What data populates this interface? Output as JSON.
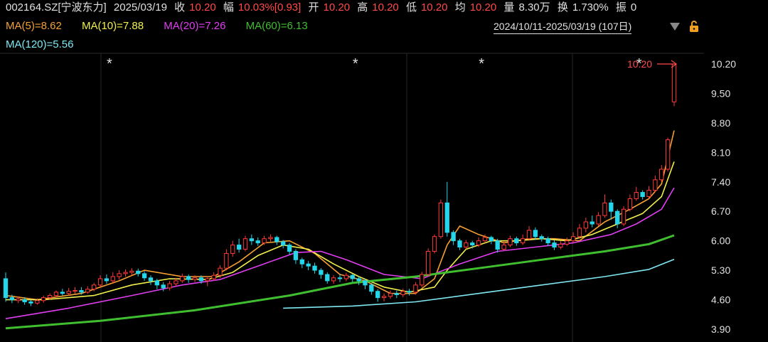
{
  "header": {
    "code": "002164.SZ[宁波东力]",
    "date": "2025/03/19",
    "close_label": "收",
    "close": "10.20",
    "change_label": "幅",
    "change": "10.03%[0.93]",
    "open_label": "开",
    "open": "10.20",
    "high_label": "高",
    "high": "10.20",
    "low_label": "低",
    "low": "10.20",
    "avg_label": "均",
    "avg": "10.20",
    "vol_label": "量",
    "vol": "8.30万",
    "turnover_label": "换",
    "turnover": "1.730%",
    "amp_label": "振",
    "amp": "0"
  },
  "ma": {
    "ma5": "MA(5)=8.62",
    "ma10": "MA(10)=7.88",
    "ma20": "MA(20)=7.26",
    "ma60": "MA(60)=6.13",
    "ma120": "MA(120)=5.56"
  },
  "range_label": "2024/10/11-2025/03/19 (107日)",
  "price_marker": "10.20",
  "colors": {
    "up": "#ff3b3b",
    "down": "#25d6ea",
    "ma5": "#f5a033",
    "ma10": "#f2ef4c",
    "ma20": "#e03ef0",
    "ma60": "#3fbf2f",
    "ma120": "#7fe8f2"
  },
  "chart_data": {
    "type": "candlestick",
    "ylim": [
      3.9,
      10.6
    ],
    "yticks": [
      "10.20",
      "9.50",
      "8.80",
      "8.10",
      "7.40",
      "6.70",
      "6.00",
      "5.30",
      "4.60",
      "3.90"
    ],
    "marker_x": [
      16,
      55,
      75,
      100
    ],
    "candles": [
      [
        5.1,
        4.65,
        5.25,
        4.55
      ],
      [
        4.65,
        4.6,
        4.72,
        4.52
      ],
      [
        4.58,
        4.62,
        4.68,
        4.52
      ],
      [
        4.6,
        4.55,
        4.66,
        4.48
      ],
      [
        4.55,
        4.52,
        4.6,
        4.45
      ],
      [
        4.52,
        4.58,
        4.63,
        4.48
      ],
      [
        4.58,
        4.65,
        4.7,
        4.53
      ],
      [
        4.65,
        4.7,
        4.75,
        4.6
      ],
      [
        4.7,
        4.78,
        4.82,
        4.65
      ],
      [
        4.78,
        4.75,
        4.86,
        4.7
      ],
      [
        4.75,
        4.8,
        4.88,
        4.7
      ],
      [
        4.8,
        4.82,
        4.9,
        4.74
      ],
      [
        4.82,
        4.78,
        4.9,
        4.72
      ],
      [
        4.78,
        4.85,
        4.92,
        4.74
      ],
      [
        4.85,
        4.95,
        5.0,
        4.8
      ],
      [
        4.95,
        5.1,
        5.18,
        4.9
      ],
      [
        5.1,
        5.05,
        5.2,
        4.98
      ],
      [
        5.05,
        5.15,
        5.25,
        5.0
      ],
      [
        5.15,
        5.22,
        5.3,
        5.08
      ],
      [
        5.22,
        5.25,
        5.32,
        5.15
      ],
      [
        5.25,
        5.28,
        5.35,
        5.18
      ],
      [
        5.28,
        5.22,
        5.34,
        5.15
      ],
      [
        5.22,
        5.12,
        5.28,
        5.05
      ],
      [
        5.12,
        5.05,
        5.18,
        4.95
      ],
      [
        5.05,
        4.95,
        5.1,
        4.85
      ],
      [
        4.95,
        4.88,
        5.02,
        4.8
      ],
      [
        4.88,
        4.98,
        5.05,
        4.82
      ],
      [
        4.98,
        5.05,
        5.12,
        4.92
      ],
      [
        5.05,
        5.15,
        5.22,
        5.0
      ],
      [
        5.15,
        5.08,
        5.2,
        5.0
      ],
      [
        5.08,
        5.12,
        5.18,
        5.02
      ],
      [
        5.12,
        5.05,
        5.18,
        4.98
      ],
      [
        5.05,
        5.1,
        5.16,
        4.92
      ],
      [
        5.1,
        5.18,
        5.25,
        5.05
      ],
      [
        5.18,
        5.35,
        5.42,
        5.12
      ],
      [
        5.35,
        5.7,
        5.8,
        5.3
      ],
      [
        5.7,
        5.9,
        6.0,
        5.62
      ],
      [
        5.9,
        5.8,
        6.05,
        5.72
      ],
      [
        5.8,
        6.05,
        6.12,
        5.75
      ],
      [
        6.05,
        6.0,
        6.15,
        5.9
      ],
      [
        6.0,
        5.95,
        6.08,
        5.88
      ],
      [
        5.95,
        6.05,
        6.12,
        5.9
      ],
      [
        6.05,
        6.08,
        6.15,
        5.98
      ],
      [
        6.08,
        5.98,
        6.12,
        5.9
      ],
      [
        5.98,
        5.9,
        6.02,
        5.82
      ],
      [
        5.9,
        5.75,
        5.95,
        5.68
      ],
      [
        5.75,
        5.55,
        5.8,
        5.45
      ],
      [
        5.55,
        5.45,
        5.6,
        5.35
      ],
      [
        5.45,
        5.4,
        5.52,
        5.3
      ],
      [
        5.4,
        5.3,
        5.48,
        5.22
      ],
      [
        5.3,
        5.2,
        5.35,
        5.1
      ],
      [
        5.2,
        5.05,
        5.25,
        4.98
      ],
      [
        5.05,
        5.12,
        5.18,
        4.98
      ],
      [
        5.12,
        5.1,
        5.2,
        5.02
      ],
      [
        5.1,
        5.18,
        5.24,
        5.04
      ],
      [
        5.18,
        5.1,
        5.22,
        5.02
      ],
      [
        5.1,
        5.05,
        5.15,
        4.95
      ],
      [
        5.05,
        4.95,
        5.1,
        4.85
      ],
      [
        4.95,
        4.8,
        5.0,
        4.72
      ],
      [
        4.8,
        4.65,
        4.85,
        4.55
      ],
      [
        4.65,
        4.68,
        4.75,
        4.56
      ],
      [
        4.68,
        4.75,
        4.82,
        4.62
      ],
      [
        4.75,
        4.72,
        4.82,
        4.64
      ],
      [
        4.72,
        4.8,
        4.86,
        4.66
      ],
      [
        4.8,
        4.78,
        4.86,
        4.7
      ],
      [
        4.78,
        4.95,
        5.02,
        4.72
      ],
      [
        4.95,
        5.2,
        5.26,
        4.9
      ],
      [
        5.2,
        5.75,
        5.82,
        5.15
      ],
      [
        5.75,
        6.1,
        6.15,
        5.7
      ],
      [
        6.1,
        6.9,
        6.98,
        6.05
      ],
      [
        6.9,
        6.2,
        7.4,
        6.1
      ],
      [
        6.2,
        6.0,
        6.25,
        5.9
      ],
      [
        6.0,
        5.85,
        6.05,
        5.78
      ],
      [
        5.85,
        5.95,
        6.02,
        5.8
      ],
      [
        5.95,
        5.9,
        6.0,
        5.82
      ],
      [
        5.9,
        6.0,
        6.08,
        5.85
      ],
      [
        6.0,
        6.08,
        6.15,
        5.95
      ],
      [
        6.08,
        6.0,
        6.12,
        5.92
      ],
      [
        6.0,
        5.8,
        6.05,
        5.72
      ],
      [
        5.8,
        5.9,
        5.98,
        5.76
      ],
      [
        5.9,
        6.05,
        6.12,
        5.85
      ],
      [
        6.05,
        5.95,
        6.1,
        5.88
      ],
      [
        5.95,
        6.05,
        6.15,
        5.9
      ],
      [
        6.05,
        6.25,
        6.35,
        6.0
      ],
      [
        6.25,
        6.1,
        6.32,
        6.02
      ],
      [
        6.1,
        6.05,
        6.15,
        5.98
      ],
      [
        6.05,
        5.95,
        6.1,
        5.88
      ],
      [
        5.95,
        5.85,
        6.02,
        5.78
      ],
      [
        5.85,
        5.92,
        6.0,
        5.8
      ],
      [
        5.92,
        6.0,
        6.08,
        5.88
      ],
      [
        6.0,
        6.1,
        6.2,
        5.95
      ],
      [
        6.1,
        6.3,
        6.4,
        6.05
      ],
      [
        6.3,
        6.45,
        6.55,
        6.2
      ],
      [
        6.45,
        6.4,
        6.6,
        6.32
      ],
      [
        6.4,
        6.6,
        6.68,
        6.35
      ],
      [
        6.6,
        6.9,
        7.1,
        6.55
      ],
      [
        6.9,
        6.7,
        6.98,
        6.5
      ],
      [
        6.7,
        6.4,
        6.75,
        6.3
      ],
      [
        6.4,
        6.75,
        6.82,
        6.35
      ],
      [
        6.75,
        7.0,
        7.1,
        6.7
      ],
      [
        7.0,
        7.15,
        7.28,
        6.95
      ],
      [
        7.15,
        7.05,
        7.2,
        6.98
      ],
      [
        7.05,
        7.2,
        7.3,
        7.0
      ],
      [
        7.2,
        7.45,
        7.55,
        7.15
      ],
      [
        7.45,
        7.7,
        7.8,
        7.4
      ],
      [
        7.7,
        8.4,
        8.45,
        7.65
      ],
      [
        9.3,
        10.2,
        10.2,
        9.2
      ]
    ],
    "ma_series": [
      {
        "name": "MA(5)",
        "color_key": "ma5",
        "points": [
          [
            0,
            4.7
          ],
          [
            5,
            4.6
          ],
          [
            12,
            4.75
          ],
          [
            18,
            5.05
          ],
          [
            22,
            5.3
          ],
          [
            28,
            5.15
          ],
          [
            33,
            5.15
          ],
          [
            37,
            5.5
          ],
          [
            41,
            5.95
          ],
          [
            45,
            6.0
          ],
          [
            49,
            5.7
          ],
          [
            53,
            5.2
          ],
          [
            57,
            5.05
          ],
          [
            61,
            4.75
          ],
          [
            65,
            4.75
          ],
          [
            68,
            5.1
          ],
          [
            70,
            5.9
          ],
          [
            72,
            6.35
          ],
          [
            75,
            6.15
          ],
          [
            79,
            5.95
          ],
          [
            83,
            6.05
          ],
          [
            87,
            6.05
          ],
          [
            91,
            6.0
          ],
          [
            95,
            6.45
          ],
          [
            99,
            6.75
          ],
          [
            102,
            7.0
          ],
          [
            104,
            7.35
          ],
          [
            106,
            8.62
          ]
        ]
      },
      {
        "name": "MA(10)",
        "color_key": "ma10",
        "points": [
          [
            0,
            4.6
          ],
          [
            6,
            4.6
          ],
          [
            14,
            4.7
          ],
          [
            20,
            4.95
          ],
          [
            26,
            5.1
          ],
          [
            32,
            5.08
          ],
          [
            36,
            5.25
          ],
          [
            40,
            5.65
          ],
          [
            44,
            5.9
          ],
          [
            48,
            5.8
          ],
          [
            52,
            5.45
          ],
          [
            56,
            5.15
          ],
          [
            60,
            4.9
          ],
          [
            64,
            4.78
          ],
          [
            68,
            4.9
          ],
          [
            70,
            5.3
          ],
          [
            73,
            5.8
          ],
          [
            77,
            6.0
          ],
          [
            81,
            6.0
          ],
          [
            85,
            6.05
          ],
          [
            89,
            6.0
          ],
          [
            93,
            6.15
          ],
          [
            97,
            6.4
          ],
          [
            101,
            6.65
          ],
          [
            104,
            7.05
          ],
          [
            106,
            7.88
          ]
        ]
      },
      {
        "name": "MA(20)",
        "color_key": "ma20",
        "points": [
          [
            0,
            4.15
          ],
          [
            10,
            4.4
          ],
          [
            20,
            4.7
          ],
          [
            28,
            4.95
          ],
          [
            34,
            5.08
          ],
          [
            40,
            5.4
          ],
          [
            46,
            5.72
          ],
          [
            50,
            5.75
          ],
          [
            54,
            5.55
          ],
          [
            60,
            5.2
          ],
          [
            66,
            5.1
          ],
          [
            72,
            5.45
          ],
          [
            78,
            5.75
          ],
          [
            84,
            5.85
          ],
          [
            90,
            5.95
          ],
          [
            96,
            6.15
          ],
          [
            100,
            6.4
          ],
          [
            104,
            6.75
          ],
          [
            106,
            7.26
          ]
        ]
      },
      {
        "name": "MA(60)",
        "color_key": "ma60",
        "points": [
          [
            0,
            3.92
          ],
          [
            15,
            4.1
          ],
          [
            30,
            4.35
          ],
          [
            45,
            4.7
          ],
          [
            55,
            5.0
          ],
          [
            65,
            5.15
          ],
          [
            75,
            5.35
          ],
          [
            85,
            5.55
          ],
          [
            95,
            5.75
          ],
          [
            102,
            5.92
          ],
          [
            106,
            6.13
          ]
        ]
      },
      {
        "name": "MA(120)",
        "color_key": "ma120",
        "points": [
          [
            44,
            4.4
          ],
          [
            55,
            4.45
          ],
          [
            65,
            4.55
          ],
          [
            75,
            4.75
          ],
          [
            85,
            4.95
          ],
          [
            95,
            5.15
          ],
          [
            102,
            5.32
          ],
          [
            106,
            5.56
          ]
        ]
      }
    ]
  }
}
